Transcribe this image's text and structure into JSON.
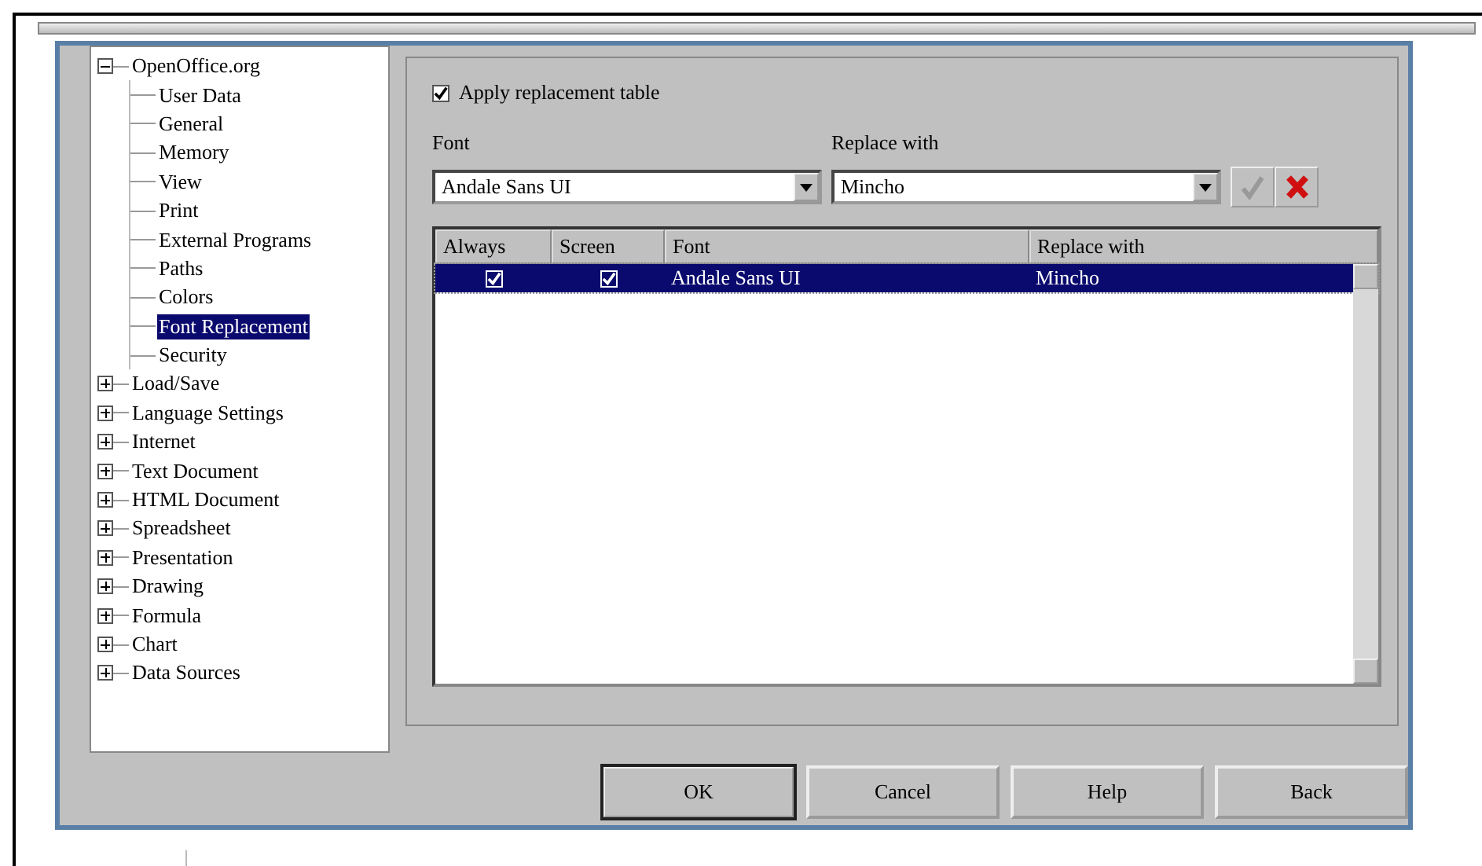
{
  "tree": [
    {
      "label": "OpenOffice.org",
      "expanded": true,
      "selected": false,
      "children": [
        {
          "label": "User Data",
          "selected": false
        },
        {
          "label": "General",
          "selected": false
        },
        {
          "label": "Memory",
          "selected": false
        },
        {
          "label": "View",
          "selected": false
        },
        {
          "label": "Print",
          "selected": false
        },
        {
          "label": "External Programs",
          "selected": false
        },
        {
          "label": "Paths",
          "selected": false
        },
        {
          "label": "Colors",
          "selected": false
        },
        {
          "label": "Font Replacement",
          "selected": true
        },
        {
          "label": "Security",
          "selected": false
        }
      ]
    },
    {
      "label": "Load/Save",
      "expanded": false,
      "selected": false
    },
    {
      "label": "Language Settings",
      "expanded": false,
      "selected": false
    },
    {
      "label": "Internet",
      "expanded": false,
      "selected": false
    },
    {
      "label": "Text Document",
      "expanded": false,
      "selected": false
    },
    {
      "label": "HTML Document",
      "expanded": false,
      "selected": false
    },
    {
      "label": "Spreadsheet",
      "expanded": false,
      "selected": false
    },
    {
      "label": "Presentation",
      "expanded": false,
      "selected": false
    },
    {
      "label": "Drawing",
      "expanded": false,
      "selected": false
    },
    {
      "label": "Formula",
      "expanded": false,
      "selected": false
    },
    {
      "label": "Chart",
      "expanded": false,
      "selected": false
    },
    {
      "label": "Data Sources",
      "expanded": false,
      "selected": false
    }
  ],
  "apply_replacement": {
    "label": "Apply replacement table",
    "checked": true
  },
  "font_field": {
    "label": "Font",
    "value": "Andale Sans UI"
  },
  "replace_field": {
    "label": "Replace with",
    "value": "Mincho"
  },
  "table": {
    "columns": [
      "Always",
      "Screen",
      "Font",
      "Replace with"
    ],
    "rows": [
      {
        "always": true,
        "screen": true,
        "font": "Andale Sans UI",
        "replace_with": "Mincho",
        "selected": true
      }
    ]
  },
  "buttons": [
    {
      "label": "OK",
      "default": true
    },
    {
      "label": "Cancel",
      "default": false
    },
    {
      "label": "Help",
      "default": false
    },
    {
      "label": "Back",
      "default": false
    }
  ]
}
